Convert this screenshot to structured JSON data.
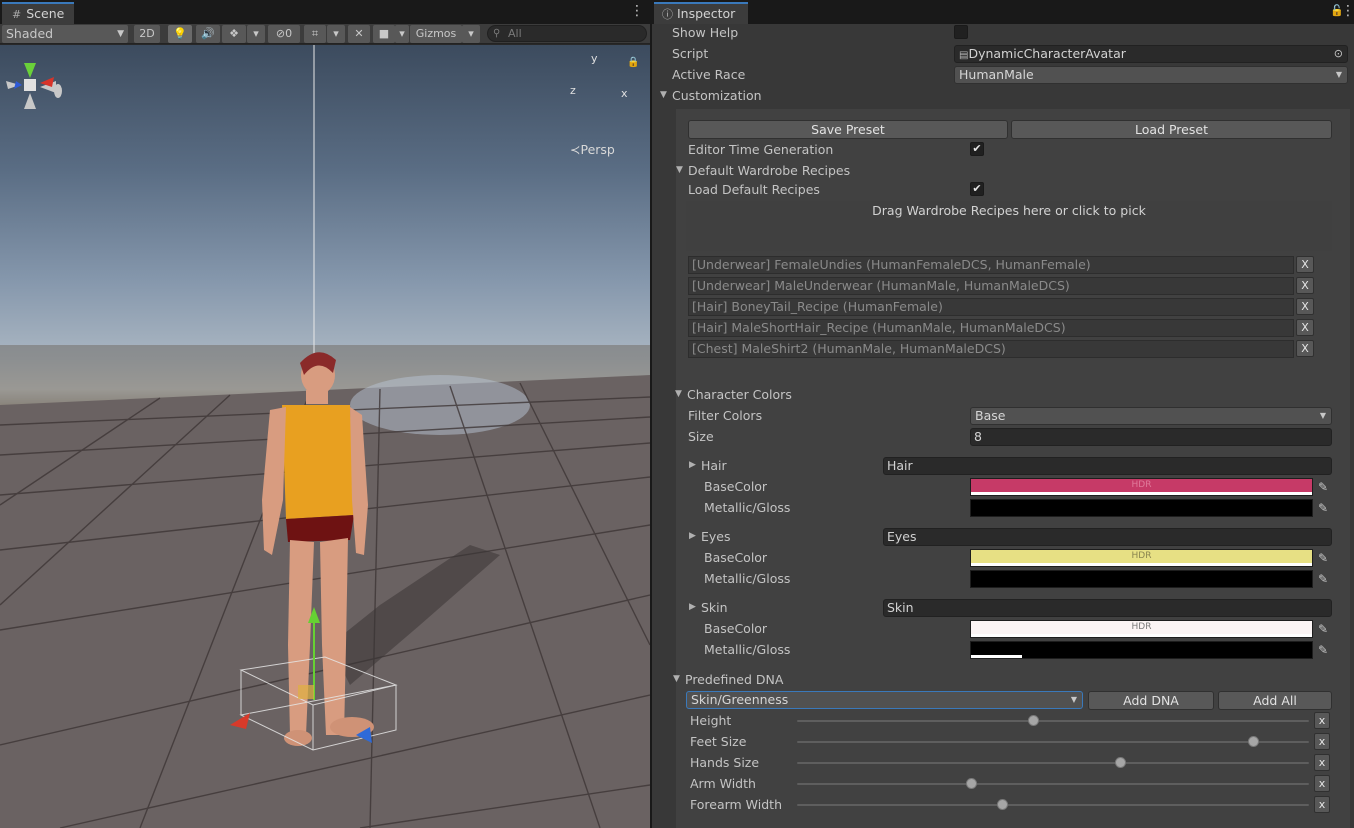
{
  "scene": {
    "tab_label": "Scene",
    "toolbar": {
      "shading_mode": "Shaded",
      "mode_2d": "2D",
      "hidden_count": "0",
      "gizmos_label": "Gizmos",
      "search_placeholder": "All"
    },
    "view_label": "Persp",
    "axis_x": "x",
    "axis_y": "y",
    "axis_z": "z"
  },
  "inspector": {
    "tab_label": "Inspector",
    "show_help_label": "Show Help",
    "script_label": "Script",
    "script_value": "DynamicCharacterAvatar",
    "active_race_label": "Active Race",
    "active_race_value": "HumanMale",
    "customization_label": "Customization",
    "save_preset": "Save Preset",
    "load_preset": "Load Preset",
    "editor_time_generation": "Editor Time Generation",
    "default_wardrobe_recipes": "Default Wardrobe Recipes",
    "load_default_recipes": "Load Default Recipes",
    "drag_hint": "Drag Wardrobe Recipes here or click to pick",
    "recipes": [
      "[Underwear] FemaleUndies (HumanFemaleDCS, HumanFemale)",
      "[Underwear] MaleUnderwear (HumanMale, HumanMaleDCS)",
      "[Hair] BoneyTail_Recipe (HumanFemale)",
      "[Hair] MaleShortHair_Recipe (HumanMale, HumanMaleDCS)",
      "[Chest] MaleShirt2 (HumanMale, HumanMaleDCS)"
    ],
    "remove_label": "X",
    "character_colors": "Character Colors",
    "filter_colors_label": "Filter Colors",
    "filter_colors_value": "Base",
    "size_label": "Size",
    "size_value": "8",
    "base_color_label": "BaseColor",
    "metallic_label": "Metallic/Gloss",
    "hdr_label": "HDR",
    "color_groups": [
      {
        "name": "Hair",
        "value": "Hair",
        "base_color": "#c63a67",
        "hdr_color": "#e07a9a",
        "metallic_alpha": 0
      },
      {
        "name": "Eyes",
        "value": "Eyes",
        "base_color": "#e7e084",
        "hdr_color": "#8a8450",
        "metallic_alpha": 0
      },
      {
        "name": "Skin",
        "value": "Skin",
        "base_color": "#fbf4f4",
        "hdr_color": "#7a7a7a",
        "metallic_alpha": 0.15
      }
    ],
    "predefined_dna": "Predefined DNA",
    "dna_select_value": "Skin/Greenness",
    "add_dna": "Add DNA",
    "add_all": "Add All",
    "dna_remove_label": "x",
    "dna": [
      {
        "label": "Height",
        "value": 0.46
      },
      {
        "label": "Feet Size",
        "value": 0.89
      },
      {
        "label": "Hands Size",
        "value": 0.63
      },
      {
        "label": "Arm Width",
        "value": 0.34
      },
      {
        "label": "Forearm Width",
        "value": 0.4
      }
    ]
  }
}
